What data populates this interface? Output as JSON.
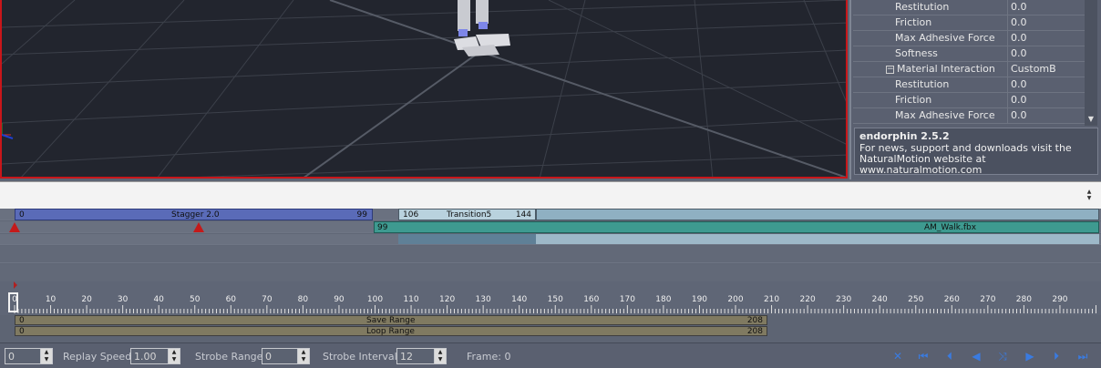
{
  "properties": [
    {
      "name": "Restitution",
      "value": "0.0",
      "group": false
    },
    {
      "name": "Friction",
      "value": "0.0",
      "group": false
    },
    {
      "name": "Max Adhesive Force",
      "value": "0.0",
      "group": false
    },
    {
      "name": "Softness",
      "value": "0.0",
      "group": false
    },
    {
      "name": "Material Interaction",
      "value": "CustomB",
      "group": true
    },
    {
      "name": "Restitution",
      "value": "0.0",
      "group": false
    },
    {
      "name": "Friction",
      "value": "0.0",
      "group": false
    },
    {
      "name": "Max Adhesive Force",
      "value": "0.0",
      "group": false
    }
  ],
  "info": {
    "title": "endorphin 2.5.2",
    "line1": "For news, support and downloads visit the",
    "line2": "NaturalMotion website at www.naturalmotion.com"
  },
  "clips": {
    "stagger": {
      "start": "0",
      "name": "Stagger 2.0",
      "end": "99"
    },
    "transition": {
      "start": "106",
      "name": "Transition5",
      "end": "144"
    },
    "walk": {
      "start": "99",
      "name": "AM_Walk.fbx"
    }
  },
  "ruler": {
    "labels": [
      "0",
      "10",
      "20",
      "30",
      "40",
      "50",
      "60",
      "70",
      "80",
      "90",
      "100",
      "110",
      "120",
      "130",
      "140",
      "150",
      "160",
      "170",
      "180",
      "190",
      "200",
      "210",
      "220",
      "230",
      "240",
      "250",
      "260",
      "270",
      "280",
      "290"
    ],
    "current_frame_label": "0"
  },
  "ranges": {
    "save": {
      "start": "0",
      "label": "Save Range",
      "end": "208"
    },
    "loop": {
      "start": "0",
      "label": "Loop Range",
      "end": "208"
    }
  },
  "toolbar": {
    "frame_input": "0",
    "replay_speed_label": "Replay Speed:",
    "replay_speed_value": "1.00",
    "strobe_range_label": "Strobe Range:",
    "strobe_range_value": "0",
    "strobe_interval_label": "Strobe Interval:",
    "strobe_interval_value": "12",
    "frame_readout": "Frame: 0"
  },
  "colors": {
    "stagger_clip": "#5a6bb8",
    "transition_clip": "#b9d2de",
    "walk_clip": "#3e9a90",
    "marker": "#c41a1a",
    "viewport_border": "#c8161a",
    "playback_icons": "#3a7be0"
  }
}
